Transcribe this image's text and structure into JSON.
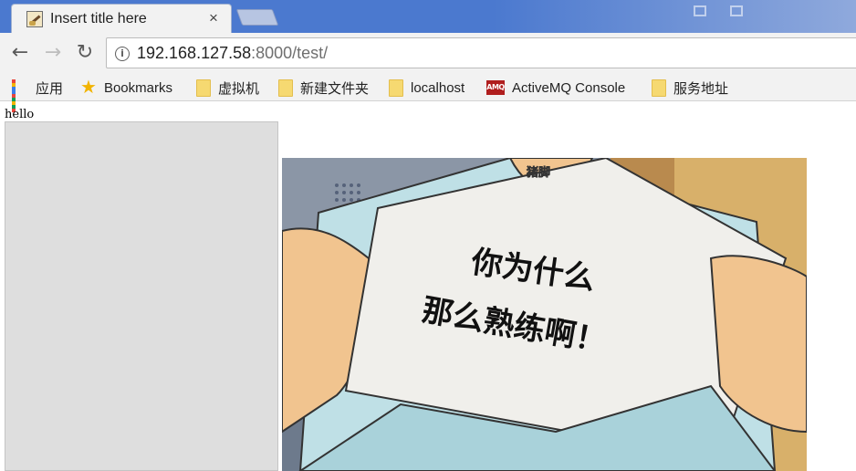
{
  "tab": {
    "title": "Insert title here",
    "close": "×"
  },
  "toolbar": {
    "back": "←",
    "forward": "→",
    "reload": "↻",
    "info": "i",
    "url_host": "192.168.127.58",
    "url_rest": ":8000/test/"
  },
  "bookmarks": [
    {
      "label": "应用",
      "icon": "apps-icon"
    },
    {
      "label": "Bookmarks",
      "icon": "star-icon"
    },
    {
      "label": "虚拟机",
      "icon": "folder-icon"
    },
    {
      "label": "新建文件夹",
      "icon": "folder-icon"
    },
    {
      "label": "localhost",
      "icon": "folder-icon"
    },
    {
      "label": "ActiveMQ Console",
      "icon": "activemq-icon"
    },
    {
      "label": "服务地址",
      "icon": "folder-icon"
    }
  ],
  "amq_logo_text": "AMQ",
  "page": {
    "hello": "hello",
    "note_line1": "你为什么",
    "note_line2": "那么熟练啊！",
    "watermark": "猪脚"
  },
  "colors": {
    "tabstrip": "#4b79cf",
    "toolbar": "#f2f2f2",
    "folder": "#f6d971",
    "star": "#f2b400"
  }
}
